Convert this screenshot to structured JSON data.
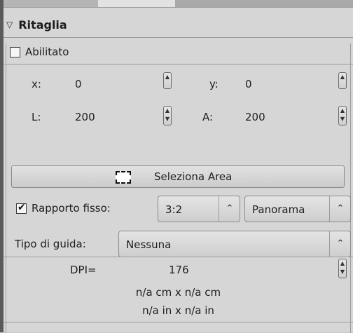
{
  "section": {
    "title": "Ritaglia",
    "collapse_icon": "triangle-down-icon"
  },
  "enabled": {
    "label": "Abilitato",
    "checked": false
  },
  "fields": {
    "x_label": "x:",
    "x_value": "0",
    "y_label": "y:",
    "y_value": "0",
    "w_label": "L:",
    "w_value": "200",
    "h_label": "A:",
    "h_value": "200"
  },
  "select_area": {
    "label": "Seleziona Area",
    "icon": "selection-rectangle-icon"
  },
  "fixed_ratio": {
    "label": "Rapporto fisso:",
    "checked": true,
    "ratio": "3:2",
    "orientation": "Panorama"
  },
  "guide": {
    "label": "Tipo di guida:",
    "value": "Nessuna"
  },
  "dpi": {
    "label": "DPI=",
    "value": "176"
  },
  "size_cm": "n/a cm x n/a cm",
  "size_in": "n/a in x n/a in"
}
